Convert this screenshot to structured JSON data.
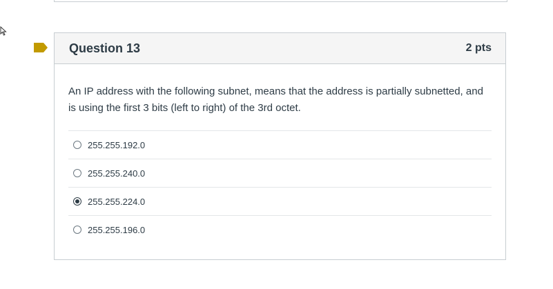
{
  "icons": {
    "cursor": "cursor-arrow-icon",
    "flag": "flag-icon",
    "flag_color": "#c29a00"
  },
  "question": {
    "title": "Question 13",
    "points": "2 pts",
    "text": "An IP address with the following subnet, means that the address is partially subnetted, and is using the first 3 bits (left to right) of the 3rd octet.",
    "answers": [
      {
        "label": "255.255.192.0",
        "selected": false
      },
      {
        "label": "255.255.240.0",
        "selected": false
      },
      {
        "label": "255.255.224.0",
        "selected": true
      },
      {
        "label": "255.255.196.0",
        "selected": false
      }
    ]
  }
}
